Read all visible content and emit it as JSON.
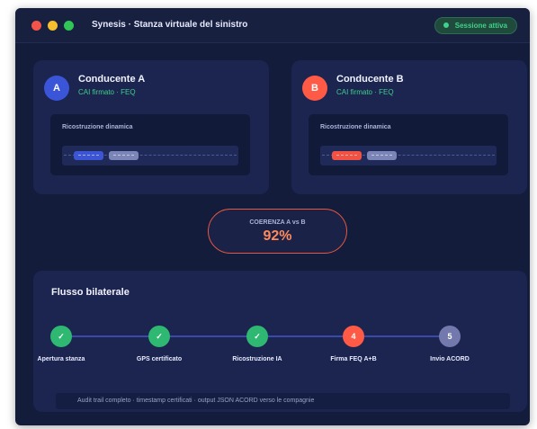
{
  "window": {
    "title": "Synesis · Stanza virtuale del sinistro",
    "session_badge": "Sessione attiva"
  },
  "drivers": [
    {
      "initial": "A",
      "name": "Conducente A",
      "status_cai": "CAI firmato",
      "status_sep": "·",
      "status_feq": "FEQ",
      "reconstruction_label": "Ricostruzione dinamica",
      "accent_color": "#3a55d8"
    },
    {
      "initial": "B",
      "name": "Conducente B",
      "status_cai": "CAI firmato",
      "status_sep": "·",
      "status_feq": "FEQ",
      "reconstruction_label": "Ricostruzione dinamica",
      "accent_color": "#ff5a46"
    }
  ],
  "coherence": {
    "label": "COERENZA A vs B",
    "value": "92%"
  },
  "flow": {
    "title": "Flusso bilaterale",
    "steps": [
      {
        "marker": "✓",
        "label": "Apertura stanza",
        "state": "done"
      },
      {
        "marker": "✓",
        "label": "GPS certificato",
        "state": "done"
      },
      {
        "marker": "✓",
        "label": "Ricostruzione IA",
        "state": "done"
      },
      {
        "marker": "4",
        "label": "Firma FEQ A+B",
        "state": "active"
      },
      {
        "marker": "5",
        "label": "Invio ACORD",
        "state": "pending"
      }
    ],
    "audit_text": "Audit trail completo · timestamp certificati · output JSON ACORD verso le compagnie"
  },
  "colors": {
    "background": "#141c3c",
    "card": "#1b2550",
    "success": "#3ed38a",
    "accent_orange": "#ff8a5a",
    "step_done": "#2eb872",
    "step_active": "#ff5a46",
    "step_pending": "#7479ad"
  }
}
